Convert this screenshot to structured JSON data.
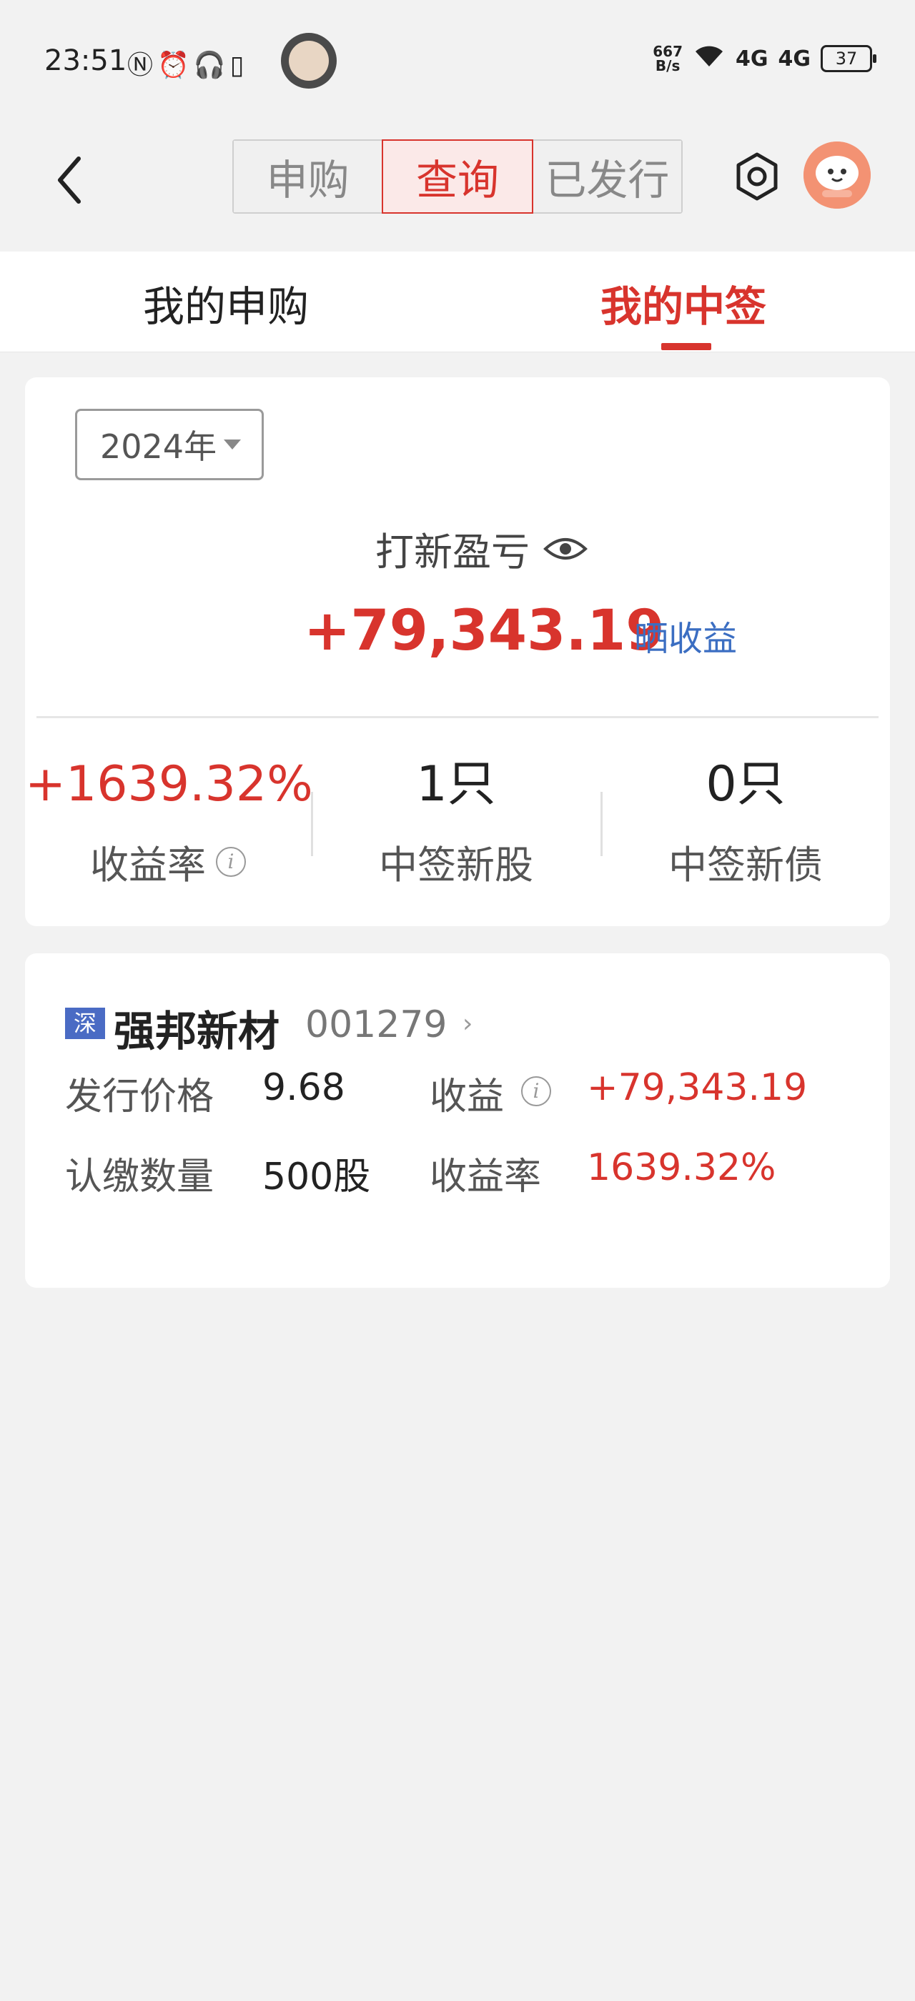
{
  "status_bar": {
    "time": "23:51",
    "left_icons": "Ⓝ⏰🎧▯",
    "net_speed_top": "667",
    "net_speed_bottom": "B/s",
    "signal1": "4G",
    "signal2": "4G",
    "battery": "37"
  },
  "header": {
    "segments": [
      "申购",
      "查询",
      "已发行"
    ],
    "active_segment": "查询"
  },
  "tabs": {
    "my_subscription": "我的申购",
    "my_allotment": "我的中签",
    "active": "我的中签"
  },
  "summary": {
    "year": "2024年",
    "pl_title": "打新盈亏",
    "pl_value": "+79,343.19",
    "share_label": "晒收益",
    "stats": {
      "return_rate": "+1639.32%",
      "return_rate_label": "收益率",
      "stocks_count": "1只",
      "stocks_label": "中签新股",
      "bonds_count": "0只",
      "bonds_label": "中签新债"
    }
  },
  "detail": {
    "exchange_badge": "深",
    "stock_name": "强邦新材",
    "stock_code": "001279",
    "issue_price_label": "发行价格",
    "issue_price": "9.68",
    "profit_label": "收益",
    "profit": "+79,343.19",
    "quantity_label": "认缴数量",
    "quantity": "500股",
    "rate_label": "收益率",
    "rate": "1639.32%"
  },
  "colors": {
    "accent_red": "#d8342d",
    "link_blue": "#3b6ec2",
    "badge_blue": "#4a6bc4"
  }
}
